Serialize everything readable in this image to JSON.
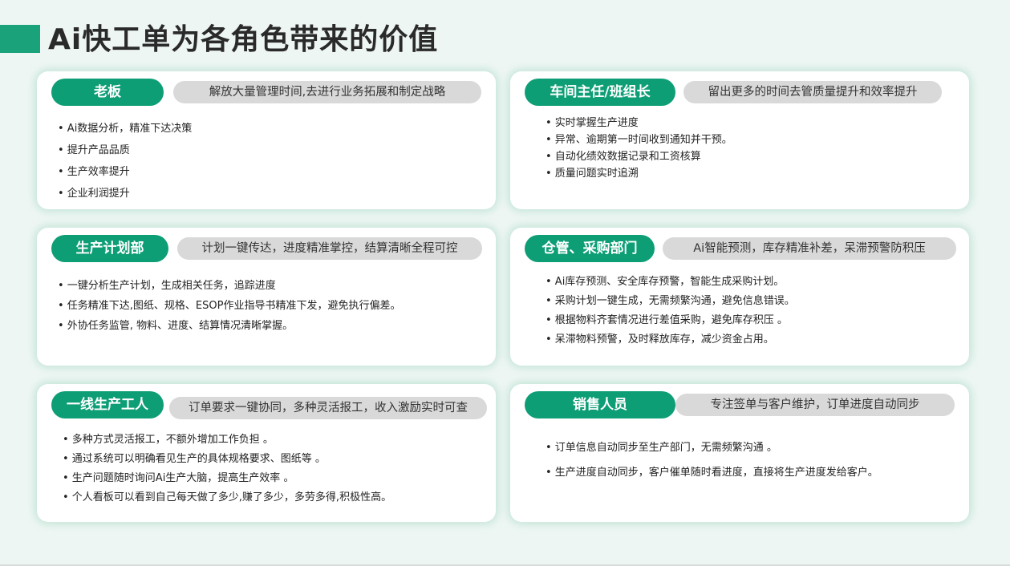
{
  "title": "Ai快工单为各角色带来的价值",
  "cards": [
    {
      "role": "老板",
      "value": "解放大量管理时间,去进行业务拓展和制定战略",
      "points": [
        "• Ai数据分析，精准下达决策",
        "• 提升产品品质",
        "• 生产效率提升",
        "• 企业利润提升"
      ]
    },
    {
      "role": "车间主任/班组长",
      "value": "留出更多的时间去管质量提升和效率提升",
      "points": [
        "• 实时掌握生产进度",
        "• 异常、逾期第一时间收到通知并干预。",
        "• 自动化绩效数据记录和工资核算",
        "• 质量问题实时追溯"
      ]
    },
    {
      "role": "生产计划部",
      "value": "计划一键传达，进度精准掌控，结算清晰全程可控",
      "points": [
        "•   一键分析生产计划，生成相关任务，追踪进度",
        "•   任务精准下达,图纸、规格、ESOP作业指导书精准下发，避免执行偏差。",
        "•   外协任务监管, 物料、进度、结算情况清晰掌握。"
      ]
    },
    {
      "role": "仓管、采购部门",
      "value": "Ai智能预测，库存精准补差，呆滞预警防积压",
      "points": [
        "• Ai库存预测、安全库存预警，智能生成采购计划。",
        "• 采购计划一键生成，无需频繁沟通，避免信息错误。",
        "• 根据物料齐套情况进行差值采购，避免库存积压 。",
        "• 呆滞物料预警，及时释放库存，减少资金占用。"
      ]
    },
    {
      "role": "一线生产工人",
      "value": "订单要求一键协同，多种灵活报工，收入激励实时可查",
      "points": [
        "• 多种方式灵活报工，不额外增加工作负担 。",
        "• 通过系统可以明确看见生产的具体规格要求、图纸等 。",
        "• 生产问题随时询问Ai生产大脑，提高生产效率 。",
        "• 个人看板可以看到自己每天做了多少,赚了多少，多劳多得,积极性高。"
      ]
    },
    {
      "role": "销售人员",
      "value": "专注签单与客户维护，订单进度自动同步",
      "points": [
        "• 订单信息自动同步至生产部门，无需频繁沟通 。",
        "• 生产进度自动同步，客户催单随时看进度，直接将生产进度发给客户。"
      ]
    }
  ]
}
